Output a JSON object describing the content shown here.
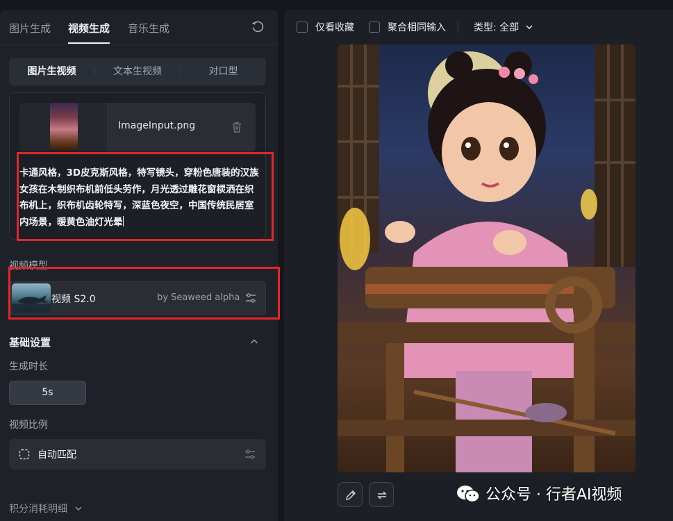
{
  "left_panel": {
    "main_tabs": [
      {
        "label": "图片生成",
        "active": false
      },
      {
        "label": "视频生成",
        "active": true
      },
      {
        "label": "音乐生成",
        "active": false
      }
    ],
    "sub_tabs": [
      {
        "label": "图片生视频",
        "active": true
      },
      {
        "label": "文本生视频",
        "active": false
      },
      {
        "label": "对口型",
        "active": false
      }
    ],
    "input": {
      "filename": "ImageInput.png",
      "prompt": "卡通风格，3D皮克斯风格，特写镜头，穿粉色唐装的汉族女孩在木制织布机前低头劳作，月光透过雕花窗棂洒在织布机上，织布机齿轮特写，深蓝色夜空，中国传统民居室内场景，暖黄色油灯光晕"
    },
    "model_section": {
      "label": "视频模型",
      "name": "视频 S2.0",
      "by": "by Seaweed alpha"
    },
    "basic_settings": {
      "title": "基础设置",
      "duration_label": "生成时长",
      "duration_value": "5s",
      "ratio_label": "视频比例",
      "ratio_value": "自动匹配"
    },
    "points_label": "积分消耗明细"
  },
  "right_panel": {
    "toolbar": {
      "favorites_only": "仅看收藏",
      "aggregate_same_input": "聚合相同输入",
      "type_filter": "类型: 全部"
    }
  },
  "watermark": {
    "text": "公众号 · 行者AI视频"
  },
  "colors": {
    "highlight_red": "#e3262a",
    "panel_bg": "#1e2128",
    "card_bg": "#2a2d34"
  }
}
